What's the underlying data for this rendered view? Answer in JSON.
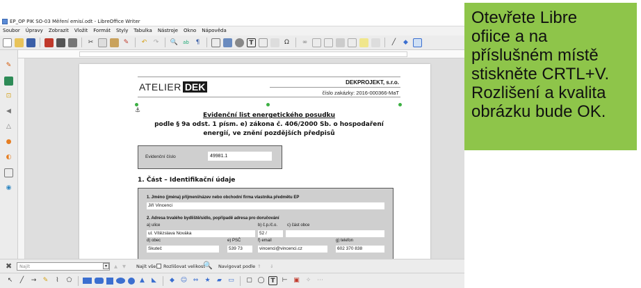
{
  "window": {
    "title": "EP_OP PIK SO-03 Měření emisí.odt - LibreOffice Writer"
  },
  "menu": [
    "Soubor",
    "Úpravy",
    "Zobrazit",
    "Vložit",
    "Formát",
    "Styly",
    "Tabulka",
    "Nástroje",
    "Okno",
    "Nápověda"
  ],
  "document": {
    "logo_left": "ATELIER",
    "logo_right": "DEK",
    "company": "DEKPROJEKT, s.r.o.",
    "zakazka": "číslo zakázky: 2016-000366-MaT",
    "title_line1": "Evidenční list energetického posudku",
    "title_line2": "podle § 9a odst. 1 písm. e) zákona č. 406/2000 Sb. o hospodaření",
    "title_line3": "energií, ve znění pozdějších předpisů",
    "evid_label": "Evidenční číslo",
    "evid_value": "49981.1",
    "section1": "1. Část – Identifikační údaje",
    "form": {
      "q1": "1. Jméno (jména) příjmení/název nebo obchodní firma vlastníka předmětu EP",
      "q1_value": "Jiří Vincenci",
      "q2": "2. Adresa trvalého bydliště/sídlo, popřípadě adresa pro doručování",
      "ulice_label": "a) ulice",
      "cp_label": "b) č.p./č.o.",
      "cast_label": "c) část obce",
      "ulice_value": "ul. Vítězslava Nováka",
      "cp_value": "52 /",
      "obec_label": "d) obec",
      "psc_label": "e) PSČ",
      "email_label": "f) email",
      "telefon_label": "g) telefon",
      "obec_value": "Skuteč",
      "psc_value": "539 73",
      "email_value": "vincenci@vincenci.cz",
      "telefon_value": "602 370 838"
    }
  },
  "findbar": {
    "placeholder": "Najít",
    "find_all": "Najít vše",
    "match_case": "Rozlišovat velikost",
    "navigate": "Navigovat podle"
  },
  "callout": {
    "lines": [
      "Otevřete Libre",
      "ofiice a na",
      "příslušném místě",
      "stiskněte CRTL+V.",
      "Rozlišení a kvalita",
      "obrázku bude OK."
    ],
    "color": "#8ec54a"
  }
}
